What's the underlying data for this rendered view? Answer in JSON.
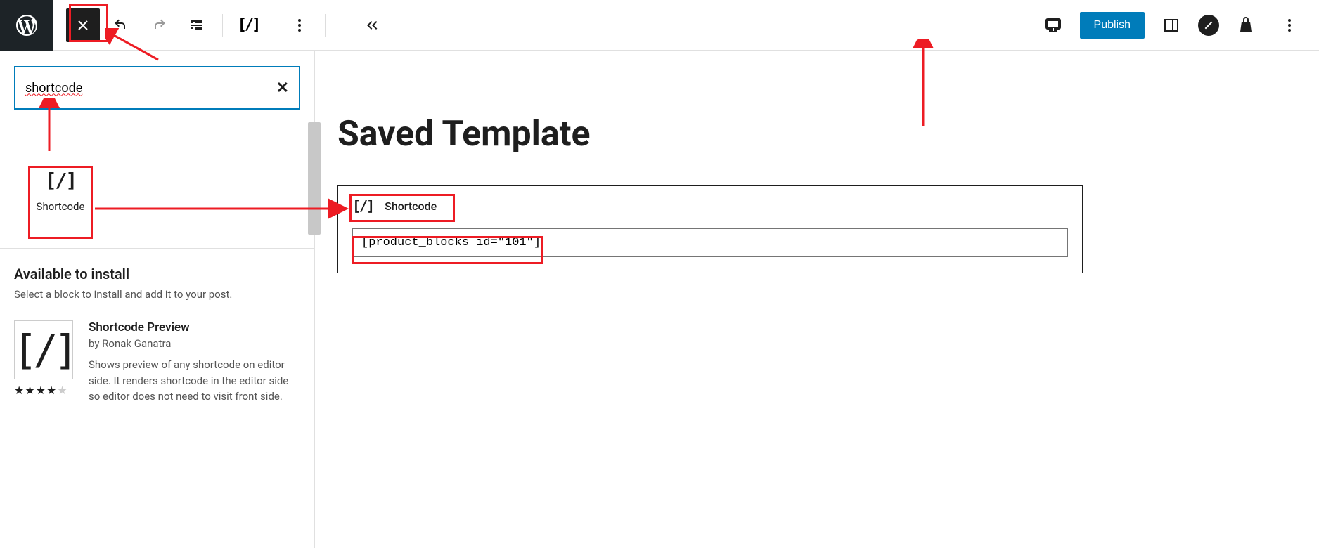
{
  "toolbar": {
    "publish_label": "Publish"
  },
  "sidebar": {
    "search_value": "shortcode",
    "block_result_label": "Shortcode",
    "install_heading": "Available to install",
    "install_sub": "Select a block to install and add it to your post.",
    "install_item": {
      "title": "Shortcode Preview",
      "author": "by Ronak Ganatra",
      "desc": "Shows preview of any shortcode on editor side. It renders shortcode in the editor side so editor does not need to visit front side.",
      "rating_full": 4,
      "rating_empty": 1
    }
  },
  "canvas": {
    "page_title": "Saved Template",
    "shortcode_label": "Shortcode",
    "shortcode_value": "[product_blocks id=\"101\"]"
  }
}
